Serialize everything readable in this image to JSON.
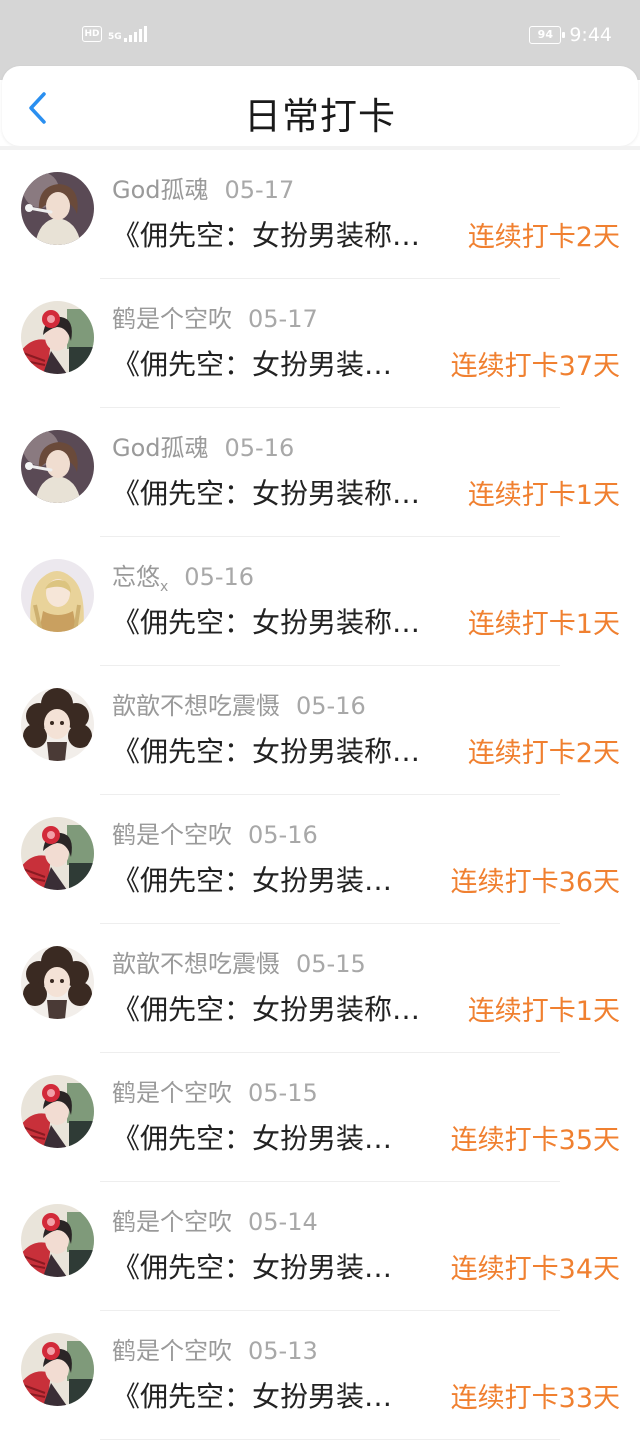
{
  "status_bar": {
    "hd": "HD",
    "network": "5G",
    "battery": "94",
    "time": "9:44"
  },
  "header": {
    "title": "日常打卡"
  },
  "colors": {
    "accent_blue": "#2a8ff0",
    "streak_orange": "#f08030"
  },
  "items": [
    {
      "user": "God孤魂",
      "user_sub": "",
      "date": "05-17",
      "post": "《佣先空：女扮男装称…",
      "streak": "连续打卡2天",
      "avatar": "god"
    },
    {
      "user": "鹤是个空吹",
      "user_sub": "",
      "date": "05-17",
      "post": "《佣先空：女扮男装…",
      "streak": "连续打卡37天",
      "avatar": "crane"
    },
    {
      "user": "God孤魂",
      "user_sub": "",
      "date": "05-16",
      "post": "《佣先空：女扮男装称…",
      "streak": "连续打卡1天",
      "avatar": "god"
    },
    {
      "user": "忘悠",
      "user_sub": "x",
      "date": "05-16",
      "post": "《佣先空：女扮男装称…",
      "streak": "连续打卡1天",
      "avatar": "blonde"
    },
    {
      "user": "歆歆不想吃震慑",
      "user_sub": "",
      "date": "05-16",
      "post": "《佣先空：女扮男装称…",
      "streak": "连续打卡2天",
      "avatar": "curly"
    },
    {
      "user": "鹤是个空吹",
      "user_sub": "",
      "date": "05-16",
      "post": "《佣先空：女扮男装…",
      "streak": "连续打卡36天",
      "avatar": "crane"
    },
    {
      "user": "歆歆不想吃震慑",
      "user_sub": "",
      "date": "05-15",
      "post": "《佣先空：女扮男装称…",
      "streak": "连续打卡1天",
      "avatar": "curly"
    },
    {
      "user": "鹤是个空吹",
      "user_sub": "",
      "date": "05-15",
      "post": "《佣先空：女扮男装…",
      "streak": "连续打卡35天",
      "avatar": "crane"
    },
    {
      "user": "鹤是个空吹",
      "user_sub": "",
      "date": "05-14",
      "post": "《佣先空：女扮男装…",
      "streak": "连续打卡34天",
      "avatar": "crane"
    },
    {
      "user": "鹤是个空吹",
      "user_sub": "",
      "date": "05-13",
      "post": "《佣先空：女扮男装…",
      "streak": "连续打卡33天",
      "avatar": "crane"
    }
  ]
}
